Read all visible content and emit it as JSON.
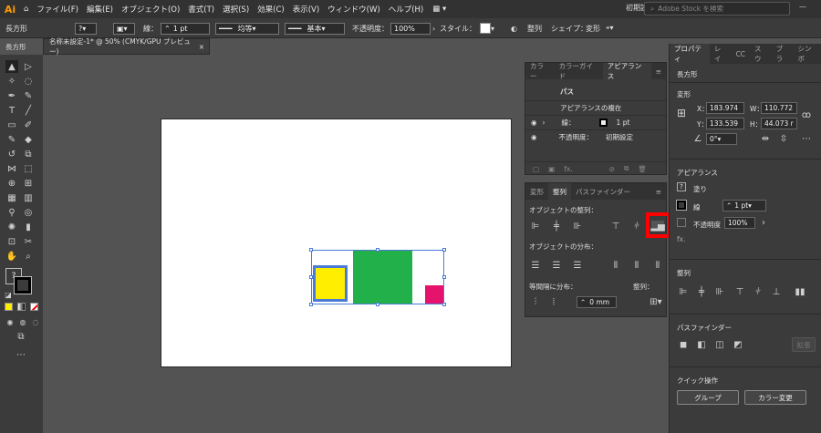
{
  "menubar": {
    "logo": "Ai",
    "items": [
      "ファイル(F)",
      "編集(E)",
      "オブジェクト(O)",
      "書式(T)",
      "選択(S)",
      "効果(C)",
      "表示(V)",
      "ウィンドウ(W)",
      "ヘルプ(H)"
    ],
    "workspace": "初期設定",
    "stock_search_placeholder": "Adobe Stock を検索"
  },
  "control": {
    "shape": "長方形",
    "stroke_label": "線：",
    "stroke_value": "1 pt",
    "profile": "均等",
    "brush": "基本",
    "opacity_label": "不透明度：",
    "opacity_value": "100%",
    "style_label": "スタイル：",
    "align_label": "整列",
    "shape_label": "シェイプ：",
    "transform_label": "変形"
  },
  "doc_tab": "名称未設定-1* @ 50% (CMYK/GPU プレビュー)",
  "appearance_panel": {
    "tabs": [
      "カラー",
      "カラーガイド",
      "アピアランス"
    ],
    "path_label": "パス",
    "rows": [
      {
        "name": "アピアランスの複在",
        "value": ""
      },
      {
        "name": "線：",
        "value": "1 pt"
      },
      {
        "name": "不透明度：",
        "value": "初期設定"
      }
    ],
    "fx": "fx."
  },
  "align_panel": {
    "tabs": [
      "変形",
      "整列",
      "パスファインダー"
    ],
    "align_objects": "オブジェクトの整列：",
    "distribute_objects": "オブジェクトの分布：",
    "distribute_spacing": "等間隔に分布：",
    "align_to": "整列：",
    "spacing_value": "0 mm"
  },
  "properties": {
    "tabs": [
      "プロパティ",
      "レイ",
      "CC",
      "スウ",
      "ブラ",
      "シンボ"
    ],
    "type": "長方形",
    "transform_header": "変形",
    "x_label": "X：",
    "x": "183.974",
    "y_label": "Y：",
    "y": "133.539",
    "w_label": "W：",
    "w": "110.772",
    "h_label": "H：",
    "h": "44.073 r",
    "angle": "0°",
    "appearance_header": "アピアランス",
    "fill_label": "塗り",
    "stroke_label": "線",
    "stroke_value": "1 pt",
    "opacity_label": "不透明度",
    "opacity_value": "100%",
    "fx": "fx.",
    "align_header": "整列",
    "pathfinder_header": "パスファインダー",
    "expand_label": "拡張",
    "quick_actions_header": "クイック操作",
    "group_button": "グループ",
    "recolor_button": "カラー変更"
  },
  "colors": {
    "yellow": "#ffee00",
    "green": "#22b04a",
    "magenta": "#e5136e",
    "selection": "#4a7bd6",
    "highlight": "#ff0000"
  }
}
